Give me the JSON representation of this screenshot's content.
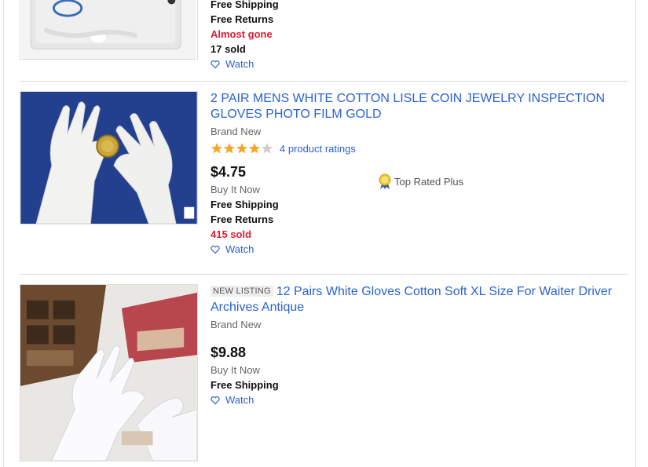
{
  "items": [
    {
      "shipping": "Free Shipping",
      "returns": "Free Returns",
      "availability": "Almost gone",
      "sold": "17 sold",
      "watch_label": "Watch",
      "image_icon": "gloves-bag-photo"
    },
    {
      "title": "2 PAIR MENS WHITE COTTON LISLE COIN JEWELRY INSPECTION GLOVES PHOTO FILM GOLD",
      "condition": "Brand New",
      "rating": 4,
      "rating_max": 5,
      "ratings_count_label": "4 product ratings",
      "price": "$4.75",
      "format": "Buy It Now",
      "shipping": "Free Shipping",
      "returns": "Free Returns",
      "sold": "415 sold",
      "watch_label": "Watch",
      "badge": "Top Rated Plus",
      "image_icon": "gloves-with-coin-photo"
    },
    {
      "new_listing_badge": "NEW LISTING",
      "title": "12 Pairs White Gloves Cotton Soft XL Size For Waiter Driver Archives Antique",
      "condition": "Brand New",
      "price": "$9.88",
      "format": "Buy It Now",
      "shipping": "Free Shipping",
      "watch_label": "Watch",
      "image_icon": "gloves-with-box-photo"
    }
  ],
  "colors": {
    "link": "#2a62d6",
    "alert_red": "#dd1e31",
    "star": "#f5a623",
    "divider": "#dddddd"
  }
}
